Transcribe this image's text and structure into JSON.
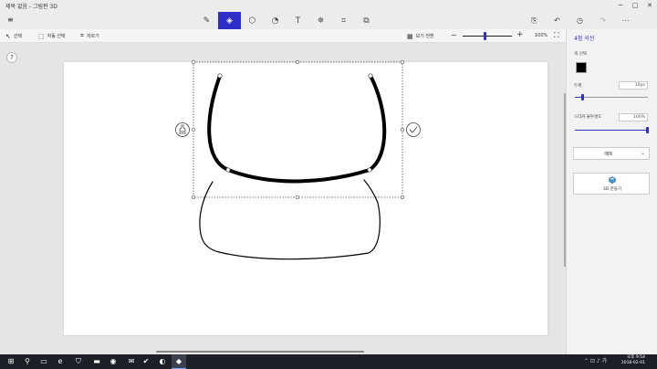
{
  "window": {
    "title": "제목 없음 - 그림판 3D",
    "buttons": [
      "─",
      "□",
      "✕"
    ]
  },
  "toolbar": {
    "menu_icon": "≡",
    "tools": [
      {
        "name": "brushes-tool",
        "glyph": "✎",
        "active": false
      },
      {
        "name": "2d-shapes-tool",
        "glyph": "◈",
        "active": true
      },
      {
        "name": "3d-shapes-tool",
        "glyph": "⬡",
        "active": false
      },
      {
        "name": "stickers-tool",
        "glyph": "◔",
        "active": false
      },
      {
        "name": "text-tool",
        "glyph": "T",
        "active": false
      },
      {
        "name": "effects-tool",
        "glyph": "✵",
        "active": false
      },
      {
        "name": "canvas-tool",
        "glyph": "⌗",
        "active": false
      },
      {
        "name": "remix3d-tool",
        "glyph": "⧉",
        "active": false
      }
    ],
    "right": [
      {
        "name": "paste-icon",
        "glyph": "⎘",
        "dim": false
      },
      {
        "name": "undo-icon",
        "glyph": "↶",
        "dim": false
      },
      {
        "name": "history-icon",
        "glyph": "◷",
        "dim": false
      },
      {
        "name": "redo-icon",
        "glyph": "↷",
        "dim": true
      },
      {
        "name": "more-icon",
        "glyph": "⋯",
        "dim": false
      }
    ]
  },
  "subbar": {
    "select_label": "선택",
    "magic_select_label": "자동 선택",
    "crop_label": "자르기",
    "view_label": "보기 전환",
    "zoom_value": "100%",
    "zoom_level": 0.45
  },
  "panel": {
    "title": "4점 곡선",
    "color_label": "색 선택",
    "color": "#000000",
    "thickness_label": "두께",
    "thickness_value": "10px",
    "thickness_level": 0.1,
    "opacity_label": "스티커 불투명도",
    "opacity_value": "100%",
    "opacity_level": 1.0,
    "finish_value": "매트",
    "make3d_label": "3D 만들기"
  },
  "taskbar": {
    "items": [
      {
        "name": "start-icon",
        "glyph": "⊞"
      },
      {
        "name": "search-icon",
        "glyph": "⚲"
      },
      {
        "name": "task-view-icon",
        "glyph": "▭"
      },
      {
        "name": "edge-icon",
        "glyph": "e"
      },
      {
        "name": "store-icon",
        "glyph": "⛉"
      },
      {
        "name": "explorer-icon",
        "glyph": "▬"
      },
      {
        "name": "chrome-icon",
        "glyph": "◉"
      },
      {
        "name": "mail-icon",
        "glyph": "✉"
      },
      {
        "name": "app-icon",
        "glyph": "✔"
      },
      {
        "name": "app2-icon",
        "glyph": "◐"
      },
      {
        "name": "paint3d-icon",
        "glyph": "◆"
      }
    ],
    "tray": "⌃ ⊡ ♪ 가",
    "time": "오후 9:54",
    "date": "2018-02-01"
  }
}
